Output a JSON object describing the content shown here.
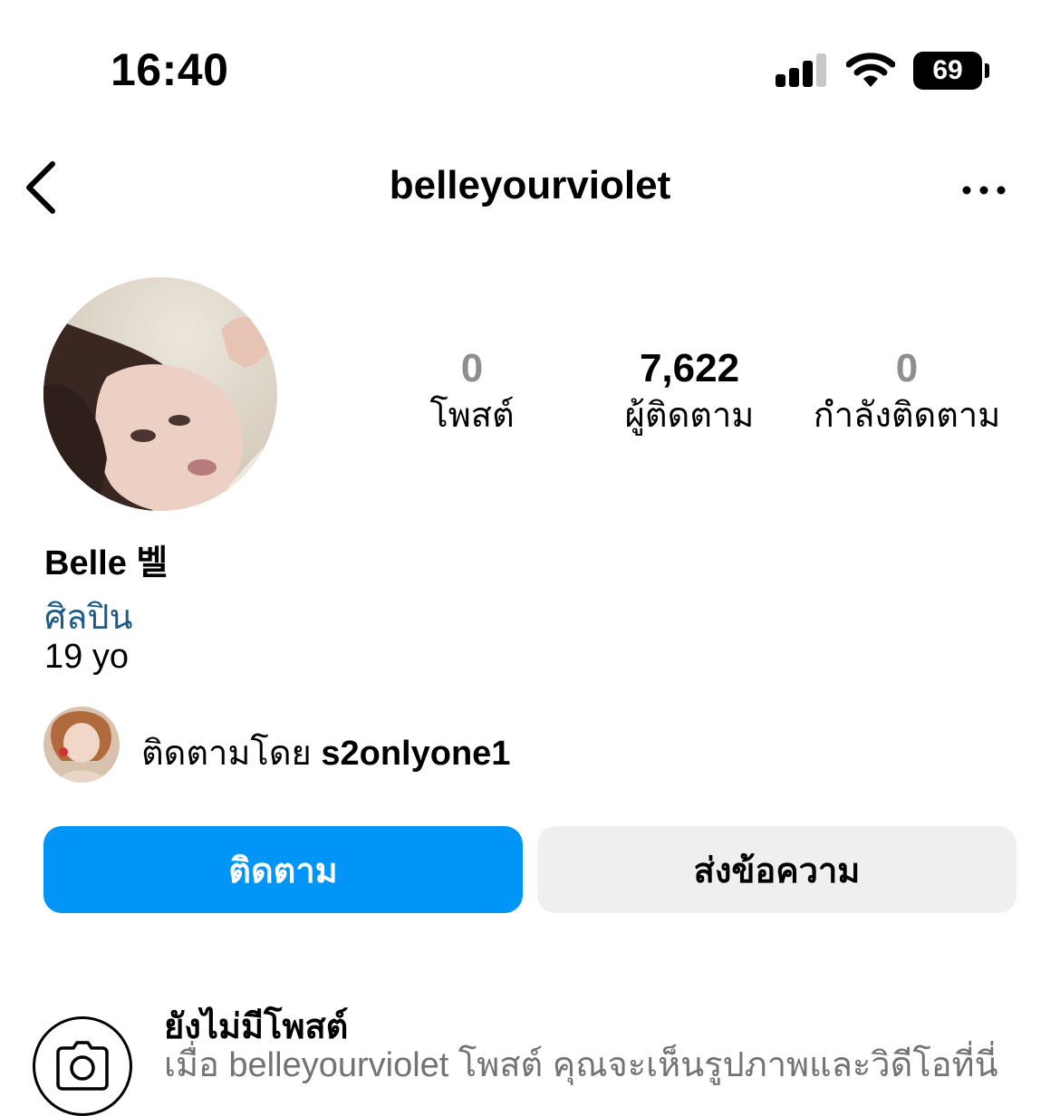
{
  "status_bar": {
    "time": "16:40",
    "battery": "69"
  },
  "header": {
    "username": "belleyourviolet"
  },
  "stats": [
    {
      "value": "0",
      "label": "โพสต์"
    },
    {
      "value": "7,622",
      "label": "ผู้ติดตาม"
    },
    {
      "value": "0",
      "label": "กำลังติดตาม"
    }
  ],
  "profile": {
    "full_name": "Belle 벨",
    "category": "ศิลปิน",
    "bio": "19 yo",
    "followed_by_prefix": "ติดตามโดย",
    "followed_by_user": "s2onlyone1"
  },
  "actions": {
    "follow_label": "ติดตาม",
    "message_label": "ส่งข้อความ"
  },
  "empty_state": {
    "title": "ยังไม่มีโพสต์",
    "description": "เมื่อ belleyourviolet โพสต์ คุณจะเห็นรูปภาพและวิดีโอที่นี่"
  },
  "colors": {
    "follow_button": "#0095f6",
    "message_button": "#efefef",
    "category_text": "#1c5a87"
  },
  "icons": [
    "back-chevron-icon",
    "more-horizontal-icon",
    "cellular-signal-icon",
    "wifi-icon",
    "battery-icon",
    "camera-icon"
  ]
}
